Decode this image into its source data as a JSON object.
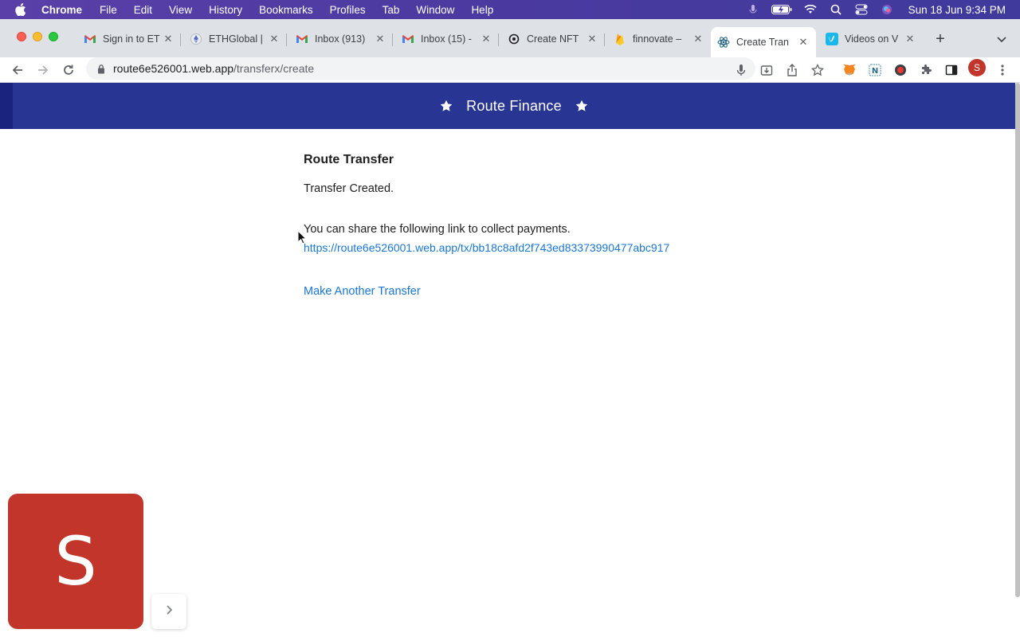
{
  "menubar": {
    "app_name": "Chrome",
    "items": [
      "File",
      "Edit",
      "View",
      "History",
      "Bookmarks",
      "Profiles",
      "Tab",
      "Window",
      "Help"
    ],
    "clock": "Sun 18 Jun  9:34 PM"
  },
  "tabs": [
    {
      "title": "Sign in to ET",
      "icon": "gmail-icon"
    },
    {
      "title": "ETHGlobal |",
      "icon": "ethglobal-icon"
    },
    {
      "title": "Inbox (913)",
      "icon": "gmail-icon"
    },
    {
      "title": "Inbox (15) -",
      "icon": "gmail-icon"
    },
    {
      "title": "Create NFT",
      "icon": "openai-icon"
    },
    {
      "title": "finnovate –",
      "icon": "firebase-icon"
    },
    {
      "title": "Create Tran",
      "icon": "react-icon",
      "active": true
    },
    {
      "title": "Videos on V",
      "icon": "vimeo-icon"
    }
  ],
  "address": {
    "host": "route6e526001.web.app",
    "path": "/transferx/create"
  },
  "profile_initial": "S",
  "app": {
    "brand": "Route Finance",
    "heading": "Route Transfer",
    "status": "Transfer Created.",
    "share_text": "You can share the following link to collect payments.",
    "share_link": "https://route6e526001.web.app/tx/bb18c8afd2f743ed83373990477abc917",
    "another_label": "Make Another Transfer"
  },
  "widget": {
    "letter": "S"
  },
  "colors": {
    "header_bg": "#283593",
    "link": "#1976d2",
    "widget_bg": "#c2352b"
  }
}
